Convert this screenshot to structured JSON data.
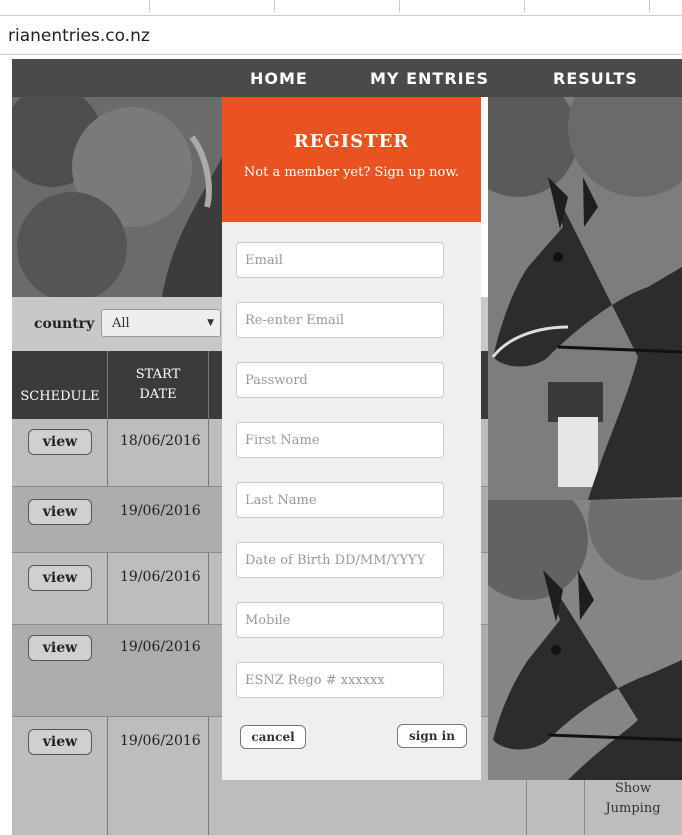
{
  "browser": {
    "url": "rianentries.co.nz"
  },
  "nav": {
    "items": [
      "HOME",
      "MY ENTRIES",
      "RESULTS"
    ]
  },
  "filter": {
    "country_label": "country",
    "country_value": "All"
  },
  "table": {
    "headers": {
      "schedule": "SCHEDULE",
      "start_date_line1": "START",
      "start_date_line2": "DATE"
    },
    "rows": [
      {
        "button": "view",
        "date": "18/06/2016"
      },
      {
        "button": "view",
        "date": "19/06/2016"
      },
      {
        "button": "view",
        "date": "19/06/2016"
      },
      {
        "button": "view",
        "date": "19/06/2016"
      },
      {
        "button": "view",
        "date": "19/06/2016"
      }
    ],
    "last_row_tail": {
      "line1": "Show",
      "line2": "Jumping"
    }
  },
  "register": {
    "title": "REGISTER",
    "subtitle": "Not a member yet? Sign up now.",
    "fields": {
      "email": "Email",
      "reenter_email": "Re-enter Email",
      "password": "Password",
      "first_name": "First Name",
      "last_name": "Last Name",
      "dob": "Date of Birth DD/MM/YYYY",
      "mobile": "Mobile",
      "esnz_rego": "ESNZ Rego # xxxxxx"
    },
    "cancel_label": "cancel",
    "signin_label": "sign in"
  },
  "colors": {
    "accent": "#e8531f",
    "nav_bg": "#4a4a4a",
    "header_bg": "#3b3b3b"
  }
}
